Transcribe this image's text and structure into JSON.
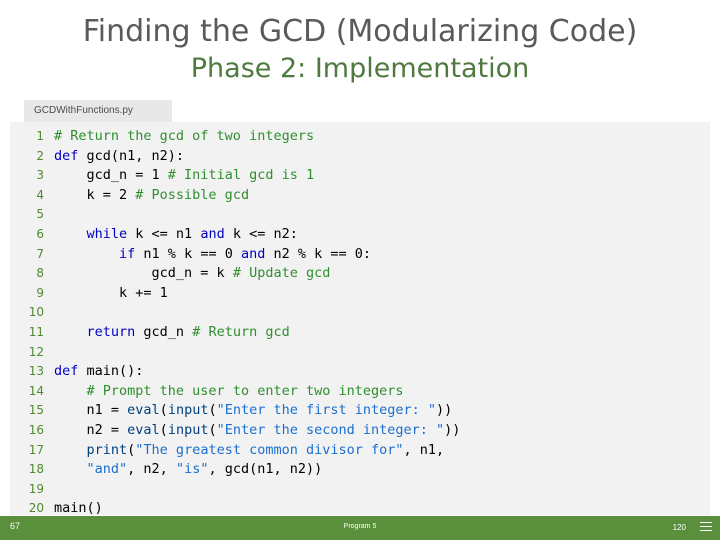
{
  "title": {
    "line1": "Finding the GCD (Modularizing Code)",
    "line2": "Phase 2: Implementation"
  },
  "file_tab": {
    "label": "GCDWithFunctions.py"
  },
  "code": {
    "lines": [
      {
        "num": "1",
        "segments": [
          {
            "t": "# Return the gcd of two integers",
            "c": "cm",
            "indent": 0
          }
        ]
      },
      {
        "num": "2",
        "segments": [
          {
            "t": "def",
            "c": "kw"
          },
          {
            "t": " gcd(n1, n2):",
            "c": "pl"
          }
        ]
      },
      {
        "num": "3",
        "segments": [
          {
            "t": "    gcd_n = 1 ",
            "c": "pl"
          },
          {
            "t": "# Initial gcd is 1",
            "c": "cm"
          }
        ]
      },
      {
        "num": "4",
        "segments": [
          {
            "t": "    k = 2 ",
            "c": "pl"
          },
          {
            "t": "# Possible gcd",
            "c": "cm"
          }
        ]
      },
      {
        "num": "5",
        "segments": [
          {
            "t": "",
            "c": "pl"
          }
        ]
      },
      {
        "num": "6",
        "segments": [
          {
            "t": "    ",
            "c": "pl"
          },
          {
            "t": "while",
            "c": "kw"
          },
          {
            "t": " k <= n1 ",
            "c": "pl"
          },
          {
            "t": "and",
            "c": "kw"
          },
          {
            "t": " k <= n2:",
            "c": "pl"
          }
        ]
      },
      {
        "num": "7",
        "segments": [
          {
            "t": "        ",
            "c": "pl"
          },
          {
            "t": "if",
            "c": "kw"
          },
          {
            "t": " n1 % k == 0 ",
            "c": "pl"
          },
          {
            "t": "and",
            "c": "kw"
          },
          {
            "t": " n2 % k == 0:",
            "c": "pl"
          }
        ]
      },
      {
        "num": "8",
        "segments": [
          {
            "t": "            gcd_n = k ",
            "c": "pl"
          },
          {
            "t": "# Update gcd",
            "c": "cm"
          }
        ]
      },
      {
        "num": "9",
        "segments": [
          {
            "t": "        k += 1",
            "c": "pl"
          }
        ]
      },
      {
        "num": "10",
        "segments": [
          {
            "t": "",
            "c": "pl"
          }
        ]
      },
      {
        "num": "11",
        "segments": [
          {
            "t": "    ",
            "c": "pl"
          },
          {
            "t": "return",
            "c": "kw"
          },
          {
            "t": " gcd_n ",
            "c": "pl"
          },
          {
            "t": "# Return gcd",
            "c": "cm"
          }
        ]
      },
      {
        "num": "12",
        "segments": [
          {
            "t": "",
            "c": "pl"
          }
        ]
      },
      {
        "num": "13",
        "segments": [
          {
            "t": "def",
            "c": "kw"
          },
          {
            "t": " main():",
            "c": "pl"
          }
        ]
      },
      {
        "num": "14",
        "segments": [
          {
            "t": "    ",
            "c": "pl"
          },
          {
            "t": "# Prompt the user to enter two integers",
            "c": "cm"
          }
        ]
      },
      {
        "num": "15",
        "segments": [
          {
            "t": "    n1 = ",
            "c": "pl"
          },
          {
            "t": "eval",
            "c": "bi"
          },
          {
            "t": "(",
            "c": "pl"
          },
          {
            "t": "input",
            "c": "bi"
          },
          {
            "t": "(",
            "c": "pl"
          },
          {
            "t": "\"Enter the first integer: \"",
            "c": "st"
          },
          {
            "t": "))",
            "c": "pl"
          }
        ]
      },
      {
        "num": "16",
        "segments": [
          {
            "t": "    n2 = ",
            "c": "pl"
          },
          {
            "t": "eval",
            "c": "bi"
          },
          {
            "t": "(",
            "c": "pl"
          },
          {
            "t": "input",
            "c": "bi"
          },
          {
            "t": "(",
            "c": "pl"
          },
          {
            "t": "\"Enter the second integer: \"",
            "c": "st"
          },
          {
            "t": "))",
            "c": "pl"
          }
        ]
      },
      {
        "num": "17",
        "segments": [
          {
            "t": "    ",
            "c": "pl"
          },
          {
            "t": "print",
            "c": "bi"
          },
          {
            "t": "(",
            "c": "pl"
          },
          {
            "t": "\"The greatest common divisor for\"",
            "c": "st"
          },
          {
            "t": ", n1,",
            "c": "pl"
          }
        ]
      },
      {
        "num": "18",
        "segments": [
          {
            "t": "    ",
            "c": "pl"
          },
          {
            "t": "\"and\"",
            "c": "st"
          },
          {
            "t": ", n2, ",
            "c": "pl"
          },
          {
            "t": "\"is\"",
            "c": "st"
          },
          {
            "t": ", gcd(n1, n2))",
            "c": "pl"
          }
        ]
      },
      {
        "num": "19",
        "segments": [
          {
            "t": "",
            "c": "pl"
          }
        ]
      },
      {
        "num": "20",
        "segments": [
          {
            "t": "main()",
            "c": "pl"
          }
        ]
      }
    ]
  },
  "footer": {
    "left": "67",
    "center": "Program 5",
    "page": "120"
  },
  "colors": {
    "accent_green": "#5a8f3c",
    "title_gray": "#5a5a5a",
    "title_green": "#4f7a3f",
    "code_bg": "#f2f2f2",
    "tab_bg": "#e8e8e8"
  }
}
